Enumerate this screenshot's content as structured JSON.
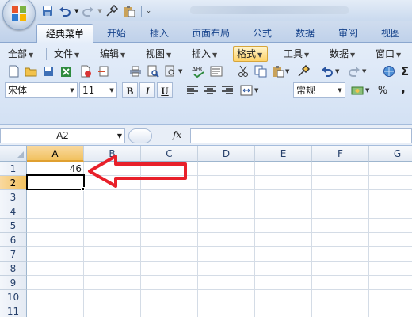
{
  "quick_access": {
    "icons": [
      "save-icon",
      "undo-icon",
      "redo-icon",
      "format-painter-icon",
      "paste-icon",
      "customize-icon"
    ]
  },
  "ribbon_tabs": [
    "经典菜单",
    "开始",
    "插入",
    "页面布局",
    "公式",
    "数据",
    "审阅",
    "视图"
  ],
  "menus": [
    "全部",
    "文件",
    "编辑",
    "视图",
    "插入",
    "格式",
    "工具",
    "数据",
    "窗口"
  ],
  "format_menu_highlight_color": "#ffd36a",
  "font": {
    "name": "宋体",
    "size": "11",
    "bold": "B",
    "italic": "I",
    "underline": "U"
  },
  "number_format": "常规",
  "number_buttons": {
    "percent": "%",
    "comma": ","
  },
  "formula_bar": {
    "name_box": "A2",
    "fx_label": "fx",
    "formula": ""
  },
  "sheet": {
    "columns": [
      "A",
      "B",
      "C",
      "D",
      "E",
      "F",
      "G"
    ],
    "rows": [
      "1",
      "2",
      "3",
      "4",
      "5",
      "6",
      "7",
      "8",
      "9",
      "10",
      "11"
    ],
    "cells": {
      "A1": "46"
    },
    "active_cell": "A2"
  },
  "annotation": {
    "arrow_color": "#e8202a",
    "points_to": "A1"
  }
}
